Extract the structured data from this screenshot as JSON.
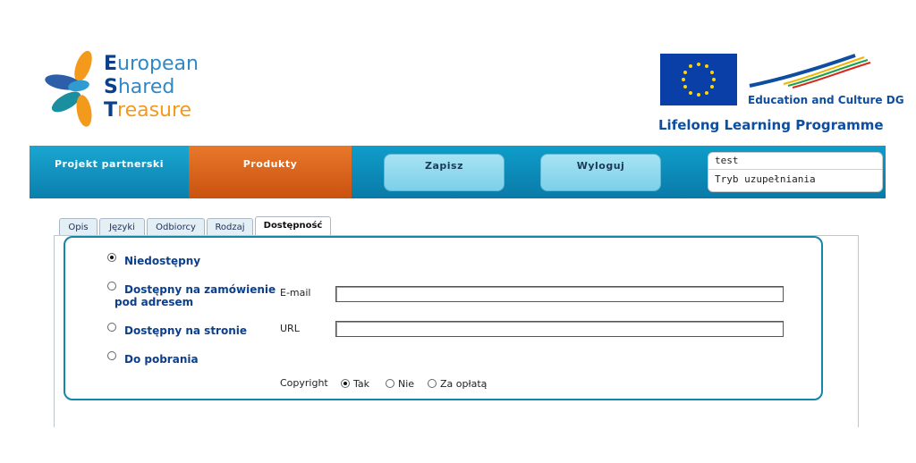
{
  "brand": {
    "logo_lines": [
      {
        "cap": "E",
        "rest": "uropean"
      },
      {
        "cap": "S",
        "rest": "hared"
      },
      {
        "cap": "T",
        "rest": "reasure"
      }
    ],
    "eu_dg": "Education and Culture DG",
    "eu_programme": "Lifelong Learning Programme"
  },
  "nav": {
    "partners": "Projekt partnerski",
    "products": "Produkty",
    "save": "Zapisz",
    "logout": "Wyloguj"
  },
  "user": {
    "name": "test",
    "mode": "Tryb uzupełniania"
  },
  "tabs": [
    "Opis",
    "Języki",
    "Odbiorcy",
    "Rodzaj",
    "Dostępność"
  ],
  "active_tab": "Dostępność",
  "availability": {
    "options": [
      {
        "label": "Niedostępny",
        "checked": true
      },
      {
        "label_line1": "Dostępny na zamówienie",
        "label_line2": "pod adresem",
        "checked": false
      },
      {
        "label": "Dostępny na stronie",
        "checked": false
      },
      {
        "label": "Do pobrania",
        "checked": false
      }
    ],
    "email_label": "E-mail",
    "email_value": "",
    "url_label": "URL",
    "url_value": "",
    "copyright_label": "Copyright",
    "copyright_options": [
      {
        "label": "Tak",
        "checked": true
      },
      {
        "label": "Nie",
        "checked": false
      },
      {
        "label": "Za opłatą",
        "checked": false
      }
    ]
  },
  "colors": {
    "nav_blue": "#0f9dc9",
    "nav_orange": "#e9782b",
    "accent_border": "#1486a8",
    "link_text": "#0d3f8a"
  }
}
